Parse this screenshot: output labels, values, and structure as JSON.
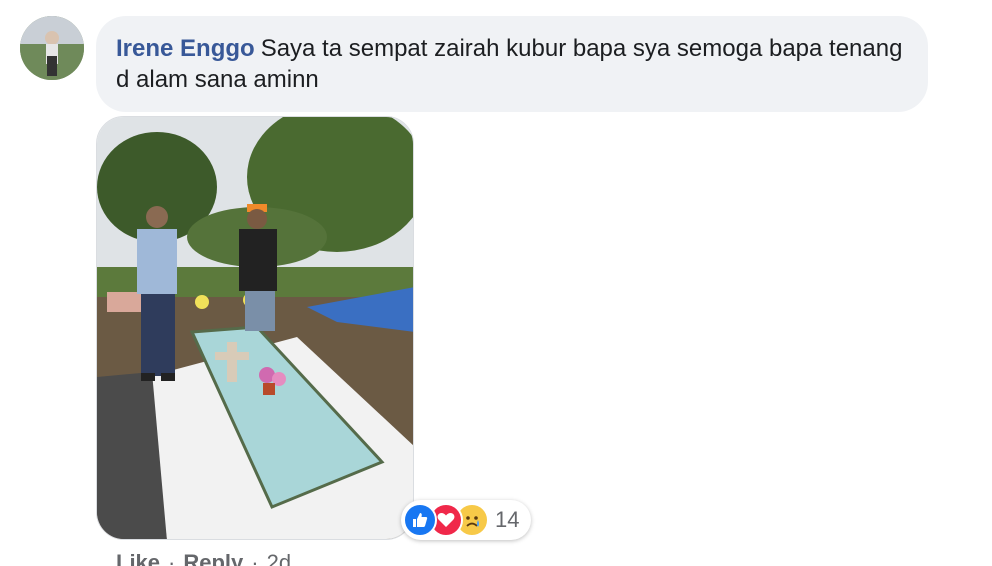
{
  "comment": {
    "author": "Irene Enggo",
    "text": "Saya ta sempat zairah kubur bapa sya semoga bapa tenang d alam sana aminn"
  },
  "reactions": {
    "icons": [
      "like-icon",
      "love-icon",
      "sad-icon"
    ],
    "count": "14"
  },
  "actions": {
    "like": "Like",
    "reply": "Reply",
    "time": "2d",
    "separator": "·"
  },
  "colors": {
    "author": "#385898",
    "bubble": "#f0f2f5",
    "like": "#1877f2",
    "love": "#f0284a",
    "sad": "#f7c948"
  }
}
